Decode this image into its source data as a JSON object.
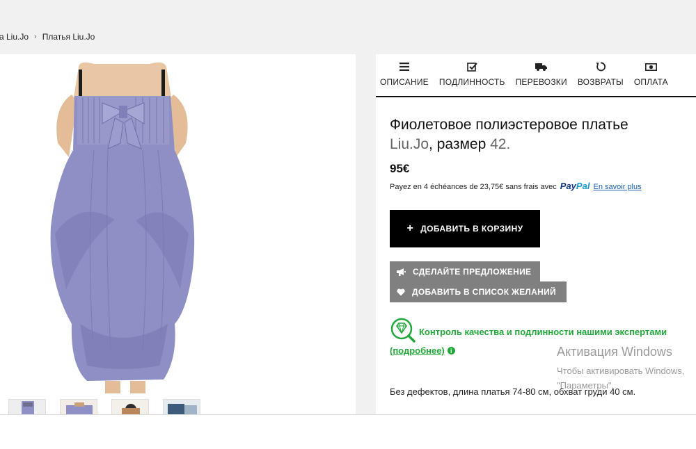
{
  "breadcrumb": {
    "items": [
      {
        "label": "да Liu.Jo"
      },
      {
        "label": "Платья Liu.Jo"
      }
    ],
    "separator": "›"
  },
  "gallery": {
    "main_image": "purple-dress-photo",
    "thumbnails": [
      "thumb-1",
      "thumb-2",
      "thumb-3",
      "thumb-4"
    ]
  },
  "tabs": [
    {
      "label": "ОПИСАНИЕ",
      "icon": "list-icon"
    },
    {
      "label": "ПОДЛИННОСТЬ",
      "icon": "checkbox-icon"
    },
    {
      "label": "ПЕРЕВОЗКИ",
      "icon": "truck-icon"
    },
    {
      "label": "ВОЗВРАТЫ",
      "icon": "undo-icon"
    },
    {
      "label": "ОПЛАТА",
      "icon": "money-icon"
    }
  ],
  "product": {
    "title_main": "Фиолетовое полиэстеровое платье",
    "brand": "Liu.Jo",
    "size_label": "размер",
    "size": "42.",
    "price": "95€",
    "paypal_text": "Payez en 4 échéances de 23,75€ sans frais avec",
    "paypal_logo_pay": "Pay",
    "paypal_logo_pal": "Pal",
    "paypal_link": "En savoir plus",
    "description": "Без дефектов, длина платья 74-80 см, обхват груди 40 см."
  },
  "actions": {
    "add_to_cart": "ДОБАВИТЬ В КОРЗИНУ",
    "make_offer": "СДЕЛАЙТЕ ПРЕДЛОЖЕНИЕ",
    "add_wishlist": "ДОБАВИТЬ В СПИСОК ЖЕЛАНИЙ"
  },
  "quality": {
    "text": "Контроль качества и подлинности нашими экспертами",
    "more_link": "(подробнее)",
    "info_glyph": "i"
  },
  "watermark": {
    "title": "Активация Windows",
    "line1": "Чтобы активировать Windows,",
    "line2": "\"Параметры\"."
  },
  "colors": {
    "accent_green": "#22a83a",
    "cart_button": "#000000",
    "secondary_button": "#808080",
    "dress": "#8e8fc4",
    "paypal_blue": "#113984",
    "paypal_light": "#179bd7"
  }
}
